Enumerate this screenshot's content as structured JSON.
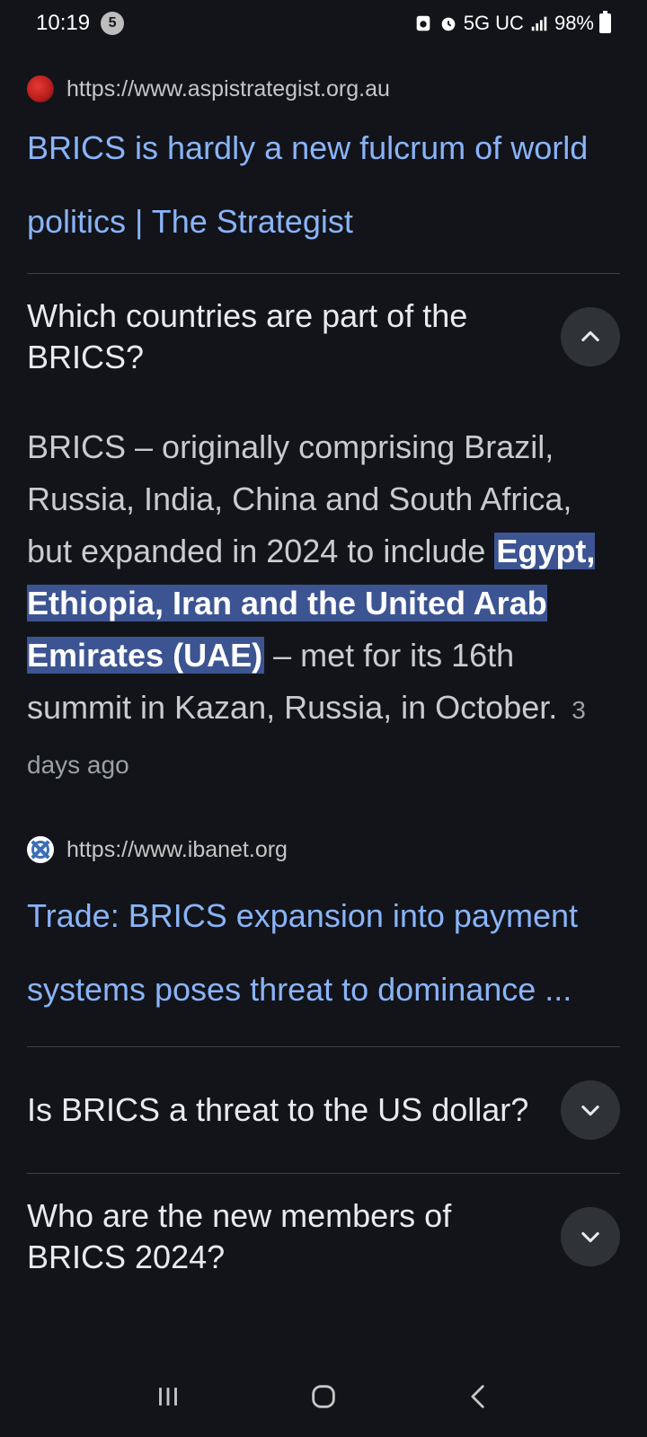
{
  "status_bar": {
    "time": "10:19",
    "notification_count": "5",
    "network": "5G UC",
    "battery": "98%",
    "icons": [
      "recycle-icon",
      "alarm-icon",
      "signal-icon",
      "battery-icon"
    ]
  },
  "results": [
    {
      "url": "https://www.aspistrategist.org.au",
      "title": "BRICS is hardly a new fulcrum of world politics | The Strategist"
    }
  ],
  "faq_open": {
    "question": "Which countries are part of the BRICS?",
    "answer_before": "BRICS – originally comprising Brazil, Russia, India, China and South Africa, but expanded in 2024 to include ",
    "answer_highlight": "Egypt, Ethiopia, Iran and the United Arab Emirates (UAE)",
    "answer_after": " – met for its 16th summit in Kazan, Russia, in October.",
    "date": "3 days ago",
    "source_url": "https://www.ibanet.org",
    "source_title": "Trade: BRICS expansion into payment systems poses threat to dominance ..."
  },
  "faq_collapsed": [
    {
      "question": "Is BRICS a threat to the US dollar?"
    },
    {
      "question": "Who are the new members of BRICS 2024?"
    }
  ],
  "colors": {
    "background": "#12141a",
    "link": "#8ab4f8",
    "highlight": "#3c5491"
  }
}
